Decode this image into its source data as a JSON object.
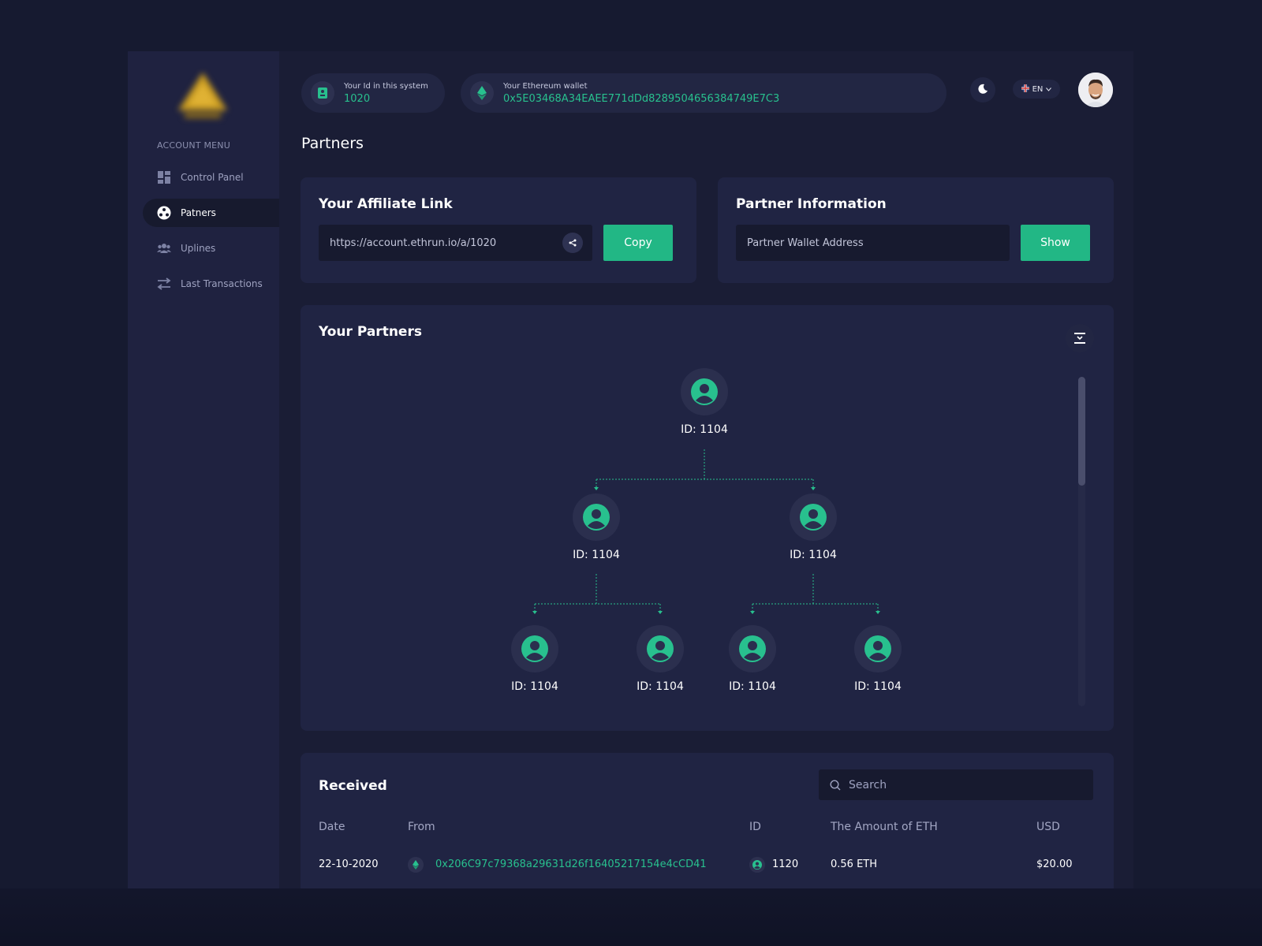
{
  "sidebar": {
    "menu_title": "ACCOUNT MENU",
    "items": [
      {
        "label": "Control Panel",
        "icon": "dashboard-icon",
        "active": false
      },
      {
        "label": "Patners",
        "icon": "network-icon",
        "active": true
      },
      {
        "label": "Uplines",
        "icon": "users-icon",
        "active": false
      },
      {
        "label": "Last Transactions",
        "icon": "transfer-icon",
        "active": false
      }
    ]
  },
  "header": {
    "id_label": "Your Id in this system",
    "id_value": "1020",
    "wallet_label": "Your Ethereum wallet",
    "wallet_value": "0x5E03468A34EAEE771dDd8289504656384749E7C3",
    "language": "EN"
  },
  "page": {
    "title": "Partners"
  },
  "affiliate": {
    "title": "Your Affiliate Link",
    "link": "https://account.ethrun.io/a/1020",
    "copy_label": "Copy"
  },
  "partner_info": {
    "title": "Partner Information",
    "placeholder": "Partner Wallet Address",
    "show_label": "Show"
  },
  "partners": {
    "title": "Your Partners",
    "root": "ID: 1104",
    "level1": [
      "ID: 1104",
      "ID: 1104"
    ],
    "level2": [
      "ID: 1104",
      "ID: 1104",
      "ID: 1104",
      "ID: 1104"
    ]
  },
  "received": {
    "title": "Received",
    "search_placeholder": "Search",
    "columns": [
      "Date",
      "From",
      "ID",
      "The Amount of ETH",
      "USD"
    ],
    "rows": [
      {
        "date": "22-10-2020",
        "from": "0x206C97c79368a29631d26f16405217154e4cCD41",
        "id": "1120",
        "eth": "0.56 ETH",
        "usd": "$20.00"
      }
    ]
  },
  "colors": {
    "accent": "#22b785",
    "background": "#161a30",
    "card": "#202443",
    "sidebar": "#1f2240"
  }
}
